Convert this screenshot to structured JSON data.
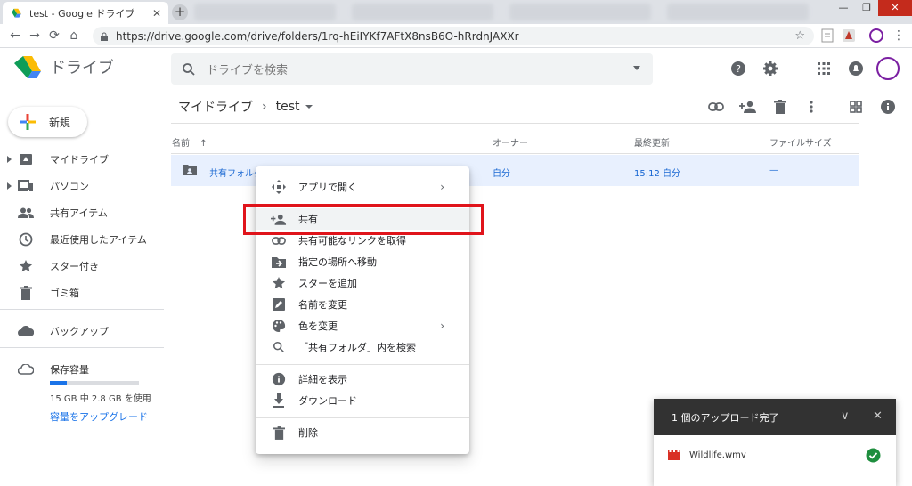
{
  "browser": {
    "tab_title": "test - Google ドライブ",
    "tab_close": "✕",
    "new_tab": "+",
    "window_controls": [
      "—",
      "❐",
      "✕"
    ],
    "url": "https://drive.google.com/drive/folders/1rq-hEiIYKf7AFtX8nsB6O-hRrdnJAXXr",
    "back": "←",
    "forward": "→",
    "reload": "⟳",
    "home": "⌂",
    "bookmark_star": "☆"
  },
  "header": {
    "app_name": "ドライブ",
    "search_placeholder": "ドライブを検索",
    "icons": [
      "help-icon",
      "settings-icon",
      "apps-grid-icon",
      "notifications-icon",
      "avatar"
    ]
  },
  "sidebar": {
    "new_label": "新規",
    "items": [
      {
        "label": "マイドライブ",
        "icon": "my-drive-icon"
      },
      {
        "label": "パソコン",
        "icon": "computers-icon"
      },
      {
        "label": "共有アイテム",
        "icon": "shared-icon"
      },
      {
        "label": "最近使用したアイテム",
        "icon": "recent-icon"
      },
      {
        "label": "スター付き",
        "icon": "star-icon"
      },
      {
        "label": "ゴミ箱",
        "icon": "trash-icon"
      }
    ],
    "backup_label": "バックアップ",
    "storage_label": "保存容量",
    "storage_used": "15 GB 中 2.8 GB を使用",
    "storage_fraction": 0.19,
    "upgrade_link": "容量をアップグレード"
  },
  "main": {
    "breadcrumb_root": "マイドライブ",
    "breadcrumb_sep": "›",
    "breadcrumb_current": "test",
    "columns": {
      "name": "名前",
      "sort": "↑",
      "owner": "オーナー",
      "modified": "最終更新",
      "size": "ファイルサイズ"
    },
    "row": {
      "name": "共有フォルダ",
      "owner": "自分",
      "modified": "15:12 自分",
      "size": "—"
    }
  },
  "context_menu": {
    "items": [
      {
        "label": "アプリで開く",
        "icon": "open-with-icon",
        "submenu": "›"
      },
      {
        "label": "共有",
        "icon": "share-person-add-icon"
      },
      {
        "label": "共有可能なリンクを取得",
        "icon": "link-icon"
      },
      {
        "label": "指定の場所へ移動",
        "icon": "move-to-icon"
      },
      {
        "label": "スターを追加",
        "icon": "star-icon"
      },
      {
        "label": "名前を変更",
        "icon": "rename-icon"
      },
      {
        "label": "色を変更",
        "icon": "palette-icon",
        "submenu": "›"
      },
      {
        "label": "「共有フォルダ」内を検索",
        "icon": "search-icon"
      },
      {
        "label": "詳細を表示",
        "icon": "info-icon"
      },
      {
        "label": "ダウンロード",
        "icon": "download-icon"
      },
      {
        "label": "削除",
        "icon": "trash-icon"
      }
    ]
  },
  "upload_panel": {
    "title": "1 個のアップロード完了",
    "collapse": "∨",
    "close": "✕",
    "file_name": "Wildlife.wmv",
    "status": "complete"
  },
  "colors": {
    "accent": "#1a73e8",
    "selected_row": "#e8f0fe",
    "highlight_box": "#e0141b",
    "upload_header": "#323232",
    "success": "#1e8e3e"
  }
}
